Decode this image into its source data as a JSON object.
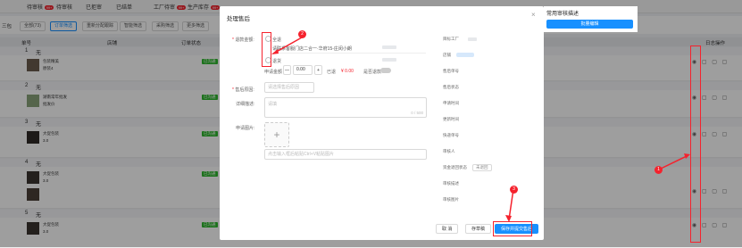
{
  "topbar": {
    "tabs": [
      {
        "label": "待审核",
        "badge": "99+"
      },
      {
        "label": "待审核"
      },
      {
        "label": "已拒审"
      },
      {
        "label": "已结单"
      },
      {
        "label": "工厂待审",
        "badge": "99+"
      },
      {
        "label": "生产库存",
        "badge": "99+"
      }
    ]
  },
  "filters": {
    "lead": "三包",
    "chips": [
      "全部(73)",
      "订单筛选",
      "重新分配跟踪",
      "智能筛选",
      "采购筛选",
      "更多筛选"
    ]
  },
  "table": {
    "col_number": "单号",
    "col_store": "店铺",
    "col_order": "订单状态",
    "col_ops": "日志操作",
    "status_tag": "已沟通",
    "rows": [
      {
        "num": "1",
        "tag": "无",
        "text1": "包装精美",
        "text2": "原装4"
      },
      {
        "num": "2",
        "tag": "无",
        "text1": "湖南常年批发",
        "text2": "批发价"
      },
      {
        "num": "3",
        "tag": "无",
        "text1": "大促包装",
        "text2": "3.0"
      },
      {
        "num": "4",
        "tag": "无",
        "text1": "大促包装",
        "text2": "3.0"
      },
      {
        "num": "5",
        "tag": "无",
        "text1": "大促包装",
        "text2": "3.0"
      }
    ]
  },
  "modal": {
    "title": "处理售后",
    "close": "×",
    "amount_label": "退款金额:",
    "option1": "全退",
    "address": "请联系客服门店二合一·华府15-庄闵小朗",
    "option2": "退货",
    "refund_row": {
      "label": "申请金额",
      "minus": "—",
      "value": "0.00",
      "plus": "+",
      "refunded": "已退",
      "refunded_amt": "¥ 0.00",
      "confirm": "是否退款"
    },
    "reason_label": "售后原因:",
    "reason_placeholder": "请选择售后原因",
    "desc_label": "详细描述:",
    "desc_placeholder": "请填",
    "desc_counter": "0 / 500",
    "img_label": "申请图片:",
    "img_plus": "+",
    "paste_placeholder": "点击输入框后粘贴Ctrl+V粘贴图片",
    "info": {
      "factory": "目标工厂",
      "store": "店铺",
      "after_sale_no": "售后单号",
      "after_sale_status": "售后状态",
      "create_time": "申请时间",
      "update_time": "更新时间",
      "express_no": "快递单号",
      "reviewer": "审核人",
      "fund_status": "资金退回状态",
      "fund_status_value": "未退回",
      "audit_desc": "审核描述",
      "audit_img": "审核图片"
    },
    "buttons": {
      "cancel": "取 消",
      "save_draft": "存草稿",
      "submit": "保存并提交售后"
    }
  },
  "side_panel": {
    "title": "常用审核描述",
    "edit_button": "批量编辑"
  },
  "annotations": [
    "1",
    "2",
    "3"
  ],
  "colors": {
    "primary": "#1890ff",
    "annotation": "#f5222d",
    "tag_green": "#2eb82e"
  }
}
